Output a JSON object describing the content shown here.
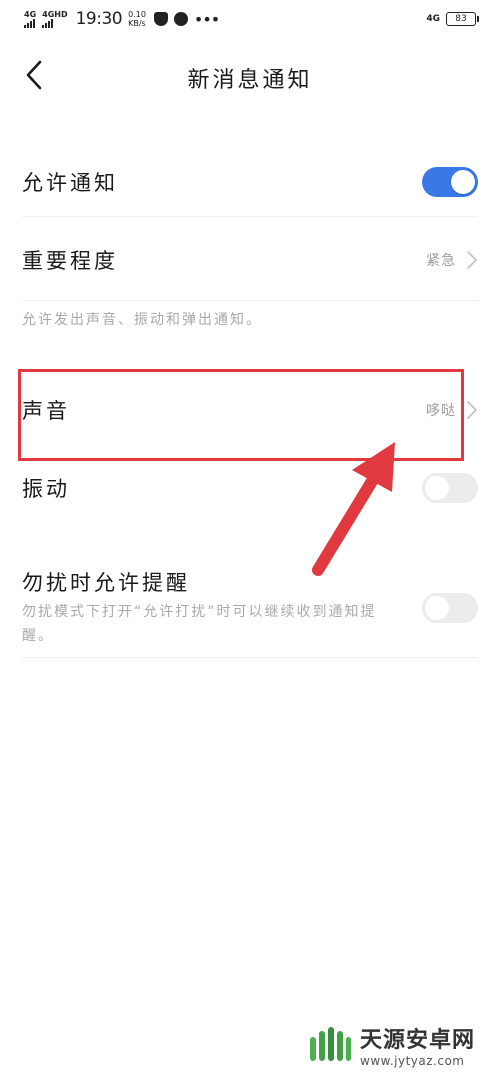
{
  "status_bar": {
    "net1": "4G",
    "net2": "4GHD",
    "time": "19:30",
    "speed_value": "0.10",
    "speed_unit": "KB/s",
    "right_net": "4G",
    "battery": "83"
  },
  "header": {
    "title": "新消息通知"
  },
  "settings": {
    "allow_notifications": {
      "label": "允许通知",
      "enabled": true
    },
    "importance": {
      "label": "重要程度",
      "value": "紧急"
    },
    "description": "允许发出声音、振动和弹出通知。",
    "sound": {
      "label": "声音",
      "value": "哆哒"
    },
    "vibration": {
      "label": "振动",
      "enabled": false
    },
    "dnd_reminder": {
      "label": "勿扰时允许提醒",
      "description": "勿扰模式下打开“允许打扰”时可以继续收到通知提醒。",
      "enabled": false
    }
  },
  "watermark": {
    "name": "天源安卓网",
    "url": "www.jytyaz.com"
  },
  "colors": {
    "accent": "#3b78e7",
    "highlight": "#e0393f"
  }
}
